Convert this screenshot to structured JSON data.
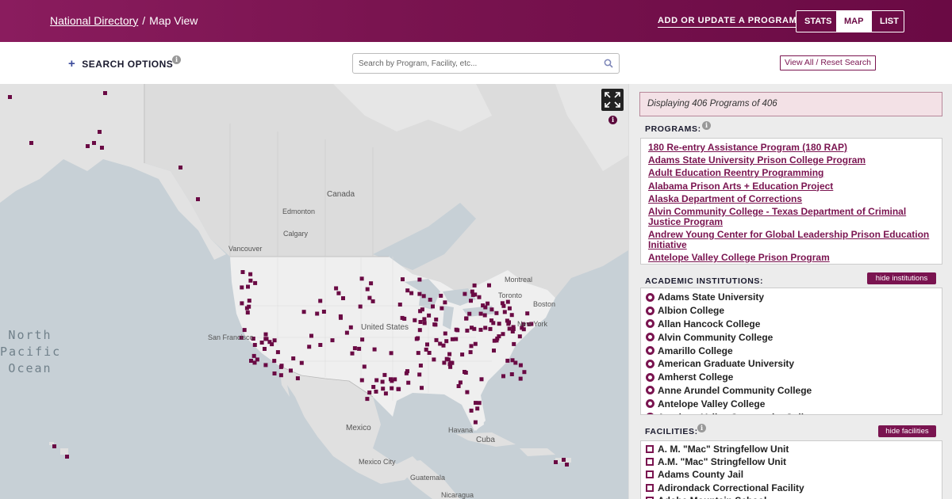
{
  "header": {
    "breadcrumb_root": "National Directory",
    "breadcrumb_sep": "/",
    "breadcrumb_current": "Map View",
    "add_program_label": "ADD OR UPDATE A PROGRAM",
    "tabs": {
      "stats": "STATS",
      "map": "MAP",
      "list": "LIST"
    },
    "active_tab": "map"
  },
  "search": {
    "options_plus": "+",
    "options_label": "SEARCH OPTIONS",
    "info_glyph": "i",
    "placeholder": "Search by Program, Facility, etc...",
    "value": "",
    "search_icon": "search-icon",
    "view_all_label": "View All / Reset Search"
  },
  "map": {
    "labels": {
      "canada": "Canada",
      "edmonton": "Edmonton",
      "calgary": "Calgary",
      "vancouver": "Vancouver",
      "montreal": "Montreal",
      "toronto": "Toronto",
      "boston": "Boston",
      "new_york": "New York",
      "united_states": "United States",
      "san_francisco": "San Francisco",
      "mexico": "Mexico",
      "mexico_city": "Mexico City",
      "cuba": "Cuba",
      "havana": "Havana",
      "guatemala": "Guatemala",
      "nicaragua": "Nicaragua"
    },
    "ocean_lines": [
      "North",
      "Pacific",
      "Ocean"
    ],
    "info_glyph": "i",
    "marker_color": "#6a0a44",
    "fullscreen_icon": "expand-icon"
  },
  "panel": {
    "displaying": "Displaying 406 Programs of 406",
    "programs_title": "PROGRAMS:",
    "programs": [
      "180 Re-entry Assistance Program (180 RAP)",
      "Adams State University Prison College Program",
      "Adult Education Reentry Programming",
      "Alabama Prison Arts + Education Project",
      "Alaska Department of Corrections",
      "Alvin Community College - Texas Department of Criminal Justice Program",
      "Andrew Young Center for Global Leadership Prison Education Initiative",
      "Antelope Valley College Prison Program"
    ],
    "institutions_title": "ACADEMIC INSTITUTIONS:",
    "hide_institutions_label": "hide institutions",
    "institutions": [
      "Adams State University",
      "Albion College",
      "Allan Hancock College",
      "Alvin Community College",
      "Amarillo College",
      "American Graduate University",
      "Amherst College",
      "Anne Arundel Community College",
      "Antelope Valley College",
      "Antelope Valley Community College"
    ],
    "facilities_title": "FACILITIES:",
    "hide_facilities_label": "hide facilities",
    "facilities": [
      "A. M. \"Mac\" Stringfellow Unit",
      "A.M. \"Mac\" Stringfellow Unit",
      "Adams County Jail",
      "Adirondack Correctional Facility",
      "Adobe Mountain School"
    ],
    "accent_color": "#7a1450"
  }
}
